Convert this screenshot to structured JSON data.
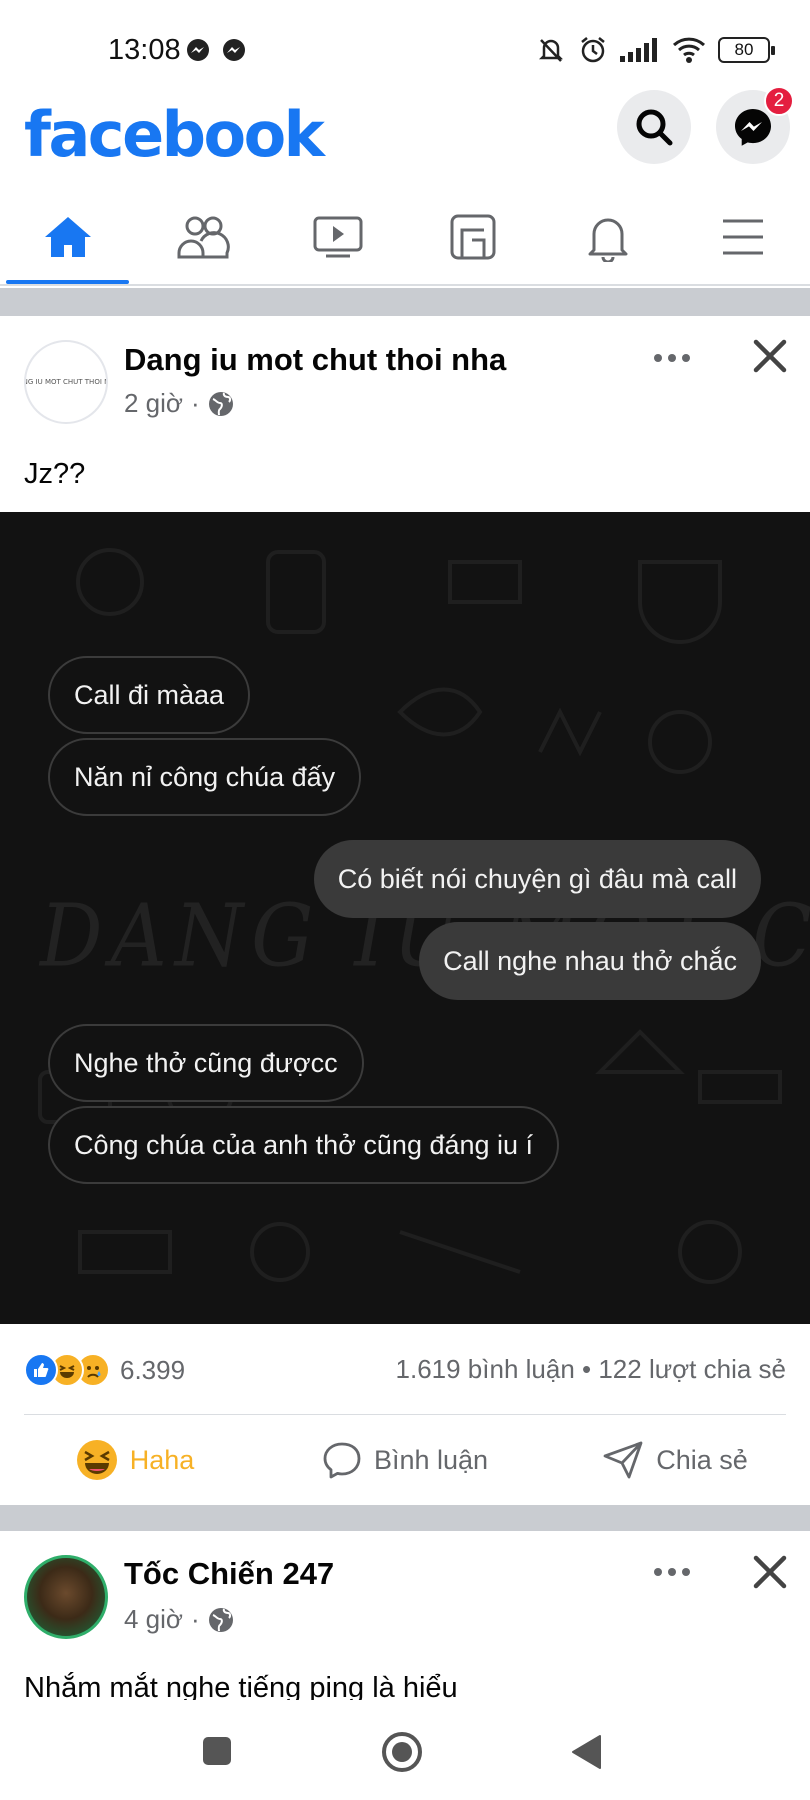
{
  "status_bar": {
    "time": "13:08",
    "battery": "80"
  },
  "header": {
    "logo": "facebook",
    "messenger_badge": "2"
  },
  "nav": {
    "tabs": [
      {
        "name": "home",
        "active": true
      },
      {
        "name": "friends",
        "active": false
      },
      {
        "name": "watch",
        "active": false
      },
      {
        "name": "marketplace",
        "active": false
      },
      {
        "name": "notifications",
        "active": false
      },
      {
        "name": "menu",
        "active": false
      }
    ]
  },
  "post1": {
    "author": "Dang iu mot chut thoi nha",
    "avatar_text": "DANG IU MOT CHUT THOI NHA",
    "time": "2 giờ",
    "separator": "·",
    "privacy_icon": "globe-icon",
    "text": "Jz??",
    "image": {
      "watermark": "DANG IU MOT CHUT THOI NHA",
      "messages": [
        {
          "side": "left",
          "text": "Call đi màaa"
        },
        {
          "side": "left",
          "text": "Năn nỉ công chúa đấy"
        },
        {
          "side": "right",
          "text": "Có biết nói chuyện gì đâu mà call"
        },
        {
          "side": "right",
          "text": "Call nghe nhau thở chắc"
        },
        {
          "side": "left",
          "text": "Nghe thở cũng đượcc"
        },
        {
          "side": "left",
          "text": "Công chúa của anh thở cũng đáng iu í"
        }
      ]
    },
    "reaction_count": "6.399",
    "stats": "1.619 bình luận • 122 lượt chia sẻ",
    "actions": {
      "haha": "Haha",
      "comment": "Bình luận",
      "share": "Chia sẻ"
    }
  },
  "post2": {
    "author": "Tốc Chiến 247",
    "time": "4 giờ",
    "separator": "·",
    "text": "Nhắm mắt nghe tiếng ping là hiểu"
  },
  "colors": {
    "brand": "#1877f2",
    "haha": "#f7b125",
    "badge": "#e41e3f"
  }
}
